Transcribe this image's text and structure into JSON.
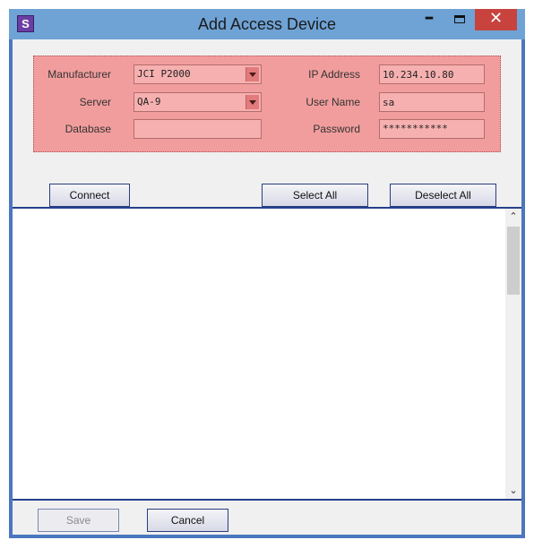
{
  "window": {
    "title": "Add Access Device",
    "app_icon_letter": "S",
    "minimize_glyph": "–",
    "close_glyph": "✕"
  },
  "form": {
    "manufacturer": {
      "label": "Manufacturer",
      "value": "JCI P2000"
    },
    "server": {
      "label": "Server",
      "value": "QA-9"
    },
    "database": {
      "label": "Database",
      "value": ""
    },
    "ip_address": {
      "label": "IP Address",
      "value": "10.234.10.80"
    },
    "user_name": {
      "label": "User Name",
      "value": "sa"
    },
    "password": {
      "label": "Password",
      "value": "***********"
    }
  },
  "buttons": {
    "connect": "Connect",
    "select_all": "Select All",
    "deselect_all": "Deselect All",
    "save": "Save",
    "cancel": "Cancel"
  },
  "scrollbar": {
    "up_glyph": "⌃",
    "down_glyph": "⌄"
  },
  "colors": {
    "title_bar": "#6fa3d6",
    "form_highlight": "#f29d9d",
    "close_button": "#c8433e"
  }
}
